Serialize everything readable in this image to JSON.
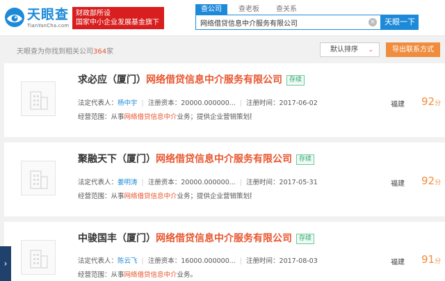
{
  "colors": {
    "brand": "#1d8ad9",
    "promo_red": "#d81e1e",
    "highlight": "#e8552e",
    "score": "#f08c3e",
    "status_green": "#2aa56e"
  },
  "logo": {
    "cn": "天眼查",
    "en": "TianYanCha.com",
    "icon": "tianyancha-logo-icon"
  },
  "promo": {
    "line1": "财政部所设",
    "line2": "国家中小企业发展基金旗下"
  },
  "search": {
    "tabs": [
      "查公司",
      "查老板",
      "查关系"
    ],
    "active_tab": 0,
    "value": "网络借贷信息中介服务有限公司",
    "clear_icon": "close-circle-icon",
    "button": "天眼一下"
  },
  "results": {
    "prefix": "天眼查为你找到相关公司",
    "count": "364",
    "suffix": "家",
    "sort_label": "默认排序",
    "export_label": "导出联系方式"
  },
  "companies": [
    {
      "name_prefix": "求必应（厦门）",
      "name_match": "网络借贷信息中介服务有限公司",
      "status": "存续",
      "rep_label": "法定代表人：",
      "rep": "杨中宇",
      "capital_label": "注册资本：",
      "capital": "20000.000000...",
      "date_label": "注册时间：",
      "date": "2017-06-02",
      "scope_label": "经营范围：",
      "scope_pre": "从事",
      "scope_hl": "网络借贷信息中介",
      "scope_rest": "业务；提供企业营销策划服务；供应链管理；接受房屋...",
      "province": "福建",
      "score": "92",
      "score_unit": "分"
    },
    {
      "name_prefix": "聚融天下（厦门）",
      "name_match": "网络借贷信息中介服务有限公司",
      "status": "存续",
      "rep_label": "法定代表人：",
      "rep": "姜明涛",
      "capital_label": "注册资本：",
      "capital": "20000.000000...",
      "date_label": "注册时间：",
      "date": "2017-05-31",
      "scope_label": "经营范围：",
      "scope_pre": "从事",
      "scope_hl": "网络借贷信息中介",
      "scope_rest": "业务；提供企业营销策划服务；供应链管理；档案处理...",
      "province": "福建",
      "score": "92",
      "score_unit": "分"
    },
    {
      "name_prefix": "中骏国丰（厦门）",
      "name_match": "网络借贷信息中介服务有限公司",
      "status": "存续",
      "rep_label": "法定代表人：",
      "rep": "陈云飞",
      "capital_label": "注册资本：",
      "capital": "16000.000000...",
      "date_label": "注册时间：",
      "date": "2017-08-03",
      "scope_label": "经营范围：",
      "scope_pre": "从事",
      "scope_hl": "网络借贷信息中介",
      "scope_rest": "业务。",
      "province": "福建",
      "score": "91",
      "score_unit": "分"
    }
  ],
  "side_toggle": {
    "icon": "chevron-right-icon",
    "glyph": "›"
  }
}
